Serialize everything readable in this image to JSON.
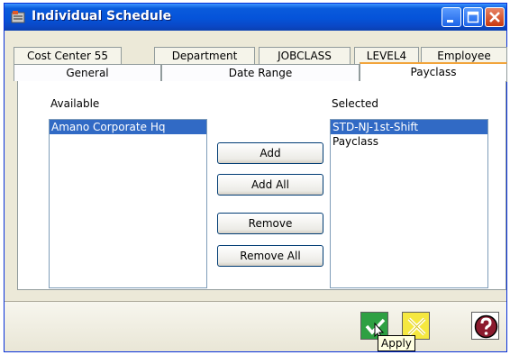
{
  "window": {
    "title": "Individual Schedule",
    "buttons": {
      "minimize": "minimize-icon",
      "maximize": "maximize-icon",
      "close": "close-icon"
    }
  },
  "tabs": {
    "back_row": [
      "Cost Center 55",
      "Department",
      "JOBCLASS",
      "LEVEL4",
      "Employee"
    ],
    "front_row": [
      "General",
      "Date Range",
      "Payclass"
    ],
    "active": "Payclass"
  },
  "available": {
    "label": "Available",
    "items": [
      "Amano Corporate Hq"
    ],
    "selected_item": "Amano Corporate Hq"
  },
  "selected": {
    "label": "Selected",
    "items": [
      "STD-NJ-1st-Shift",
      "Payclass"
    ],
    "selected_item": "STD-NJ-1st-Shift"
  },
  "actions": {
    "add": "Add",
    "add_all": "Add All",
    "remove": "Remove",
    "remove_all": "Remove All"
  },
  "bottom": {
    "apply_icon": "check-icon",
    "cancel_icon": "x-icon",
    "help_icon": "question-icon",
    "tooltip": "Apply"
  },
  "colors": {
    "titlebar": "#0553d9",
    "selection": "#316ac5",
    "active_tab_accent": "#f2a43b",
    "apply_button": "#2ea043",
    "cancel_button": "#f5e840",
    "help_button": "#8b1a2e"
  }
}
